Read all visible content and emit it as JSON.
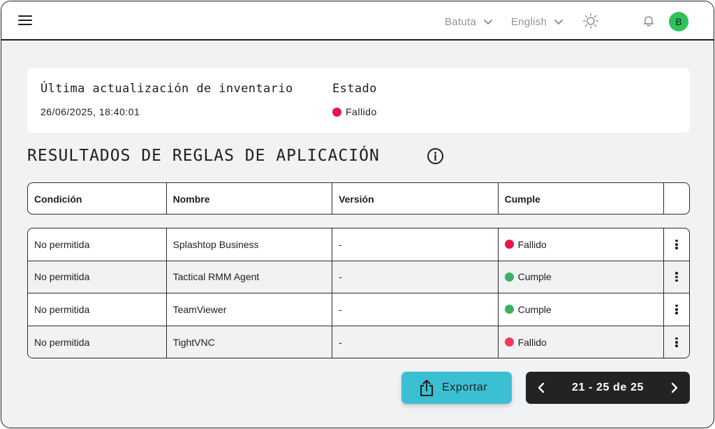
{
  "header": {
    "menu_icon": "hamburger-icon",
    "organization": "Batuta",
    "language": "English",
    "theme_icon": "sun-icon",
    "notifications_icon": "bell-icon",
    "avatar_initial": "B",
    "avatar_color": "#2fc25b"
  },
  "inventory": {
    "last_update_label": "Última actualización de inventario",
    "last_update_value": "26/06/2025, 18:40:01",
    "status_label": "Estado",
    "status_value": "Fallido",
    "status_color": "#e3174e"
  },
  "section": {
    "title": "RESULTADOS DE REGLAS DE APLICACIÓN",
    "info_icon": "info-icon"
  },
  "table": {
    "columns": [
      "Condición",
      "Nombre",
      "Versión",
      "Cumple",
      ""
    ],
    "rows": [
      {
        "condition": "No permitida",
        "name": "Splashtop Business",
        "version": "-",
        "status": "Fallido",
        "status_color": "#e3174e"
      },
      {
        "condition": "No permitida",
        "name": "Tactical RMM Agent",
        "version": "-",
        "status": "Cumple",
        "status_color": "#3cb15e"
      },
      {
        "condition": "No permitida",
        "name": "TeamViewer",
        "version": "-",
        "status": "Cumple",
        "status_color": "#3cb15e"
      },
      {
        "condition": "No permitida",
        "name": "TightVNC",
        "version": "-",
        "status": "Fallido",
        "status_color": "#ec3b5f"
      }
    ]
  },
  "actions": {
    "export_label": "Exportar",
    "export_icon": "share-upload-icon",
    "export_color": "#3bbfd3"
  },
  "pagination": {
    "text": "21 - 25 de 25",
    "prev_icon": "chevron-left-icon",
    "next_icon": "chevron-right-icon"
  }
}
